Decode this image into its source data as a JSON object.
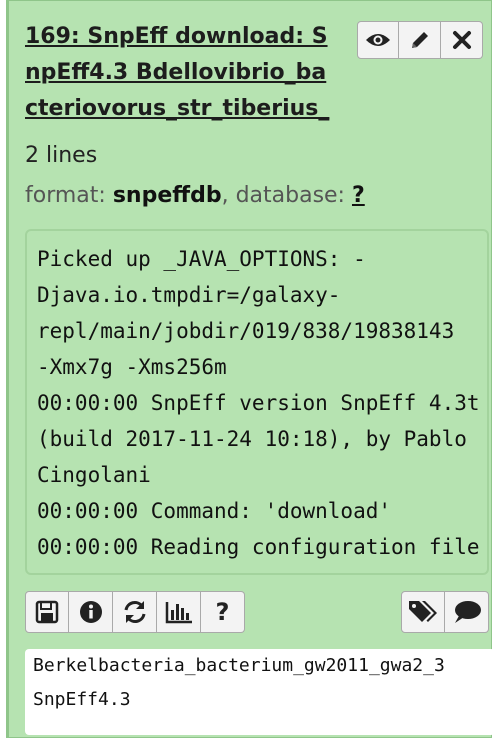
{
  "dataset": {
    "title": "169: SnpEff download: SnpEff4.3 Bdellovibrio_bacteriovorus_str_tiberius_",
    "lines": "2 lines",
    "format_label": "format:",
    "format_value": "snpeffdb",
    "database_label": ", database:",
    "database_value": "?",
    "peek_lines": [
      "Picked up _JAVA_OPTIONS: -",
      "Djava.io.tmpdir=/galaxy-",
      "repl/main/jobdir/019/838/19838143",
      "-Xmx7g -Xms256m",
      "00:00:00 SnpEff version SnpEff 4.3t",
      "(build 2017-11-24 10:18), by Pablo",
      "Cingolani",
      "00:00:00 Command: 'download'",
      "00:00:00 Reading configuration file"
    ],
    "info_lines": [
      "Berkelbacteria_bacterium_gw2011_gwa2_3",
      "SnpEff4.3"
    ]
  },
  "title_buttons": [
    "eye-icon",
    "pencil-icon",
    "close-icon"
  ],
  "action_buttons": [
    "save-icon",
    "info-icon",
    "rerun-icon",
    "chart-icon",
    "help-icon"
  ],
  "right_buttons": [
    "tags-icon",
    "comment-icon"
  ],
  "help_glyph": "?",
  "colors": {
    "background": "#b6e3b1",
    "border": "#8fc58a"
  }
}
